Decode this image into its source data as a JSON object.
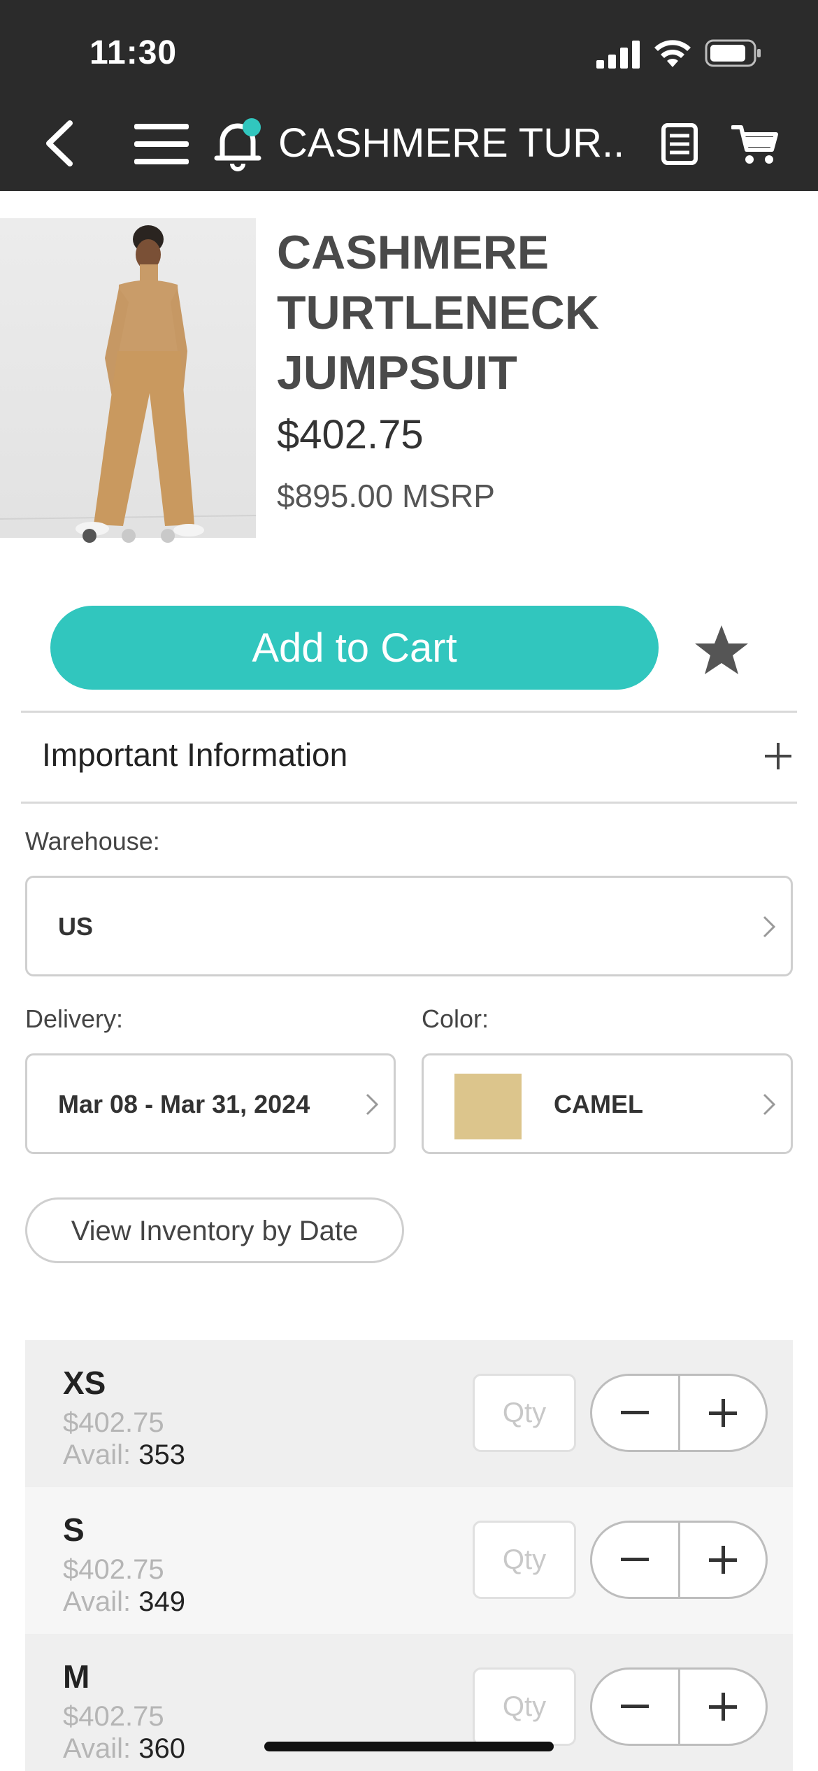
{
  "status_bar": {
    "time": "11:30"
  },
  "nav": {
    "title": "CASHMERE TUR..."
  },
  "product": {
    "name": "CASHMERE TURTLENECK JUMPSUIT",
    "price": "$402.75",
    "msrp": "$895.00 MSRP",
    "image_dots": 3,
    "active_dot": 1
  },
  "actions": {
    "add_to_cart": "Add to Cart"
  },
  "info": {
    "label": "Important Information"
  },
  "warehouse": {
    "label": "Warehouse:",
    "value": "US"
  },
  "delivery": {
    "label": "Delivery:",
    "value": "Mar 08 - Mar 31, 2024"
  },
  "color": {
    "label": "Color:",
    "value": "CAMEL",
    "swatch": "#dcc58c"
  },
  "inventory_button": "View Inventory by Date",
  "sizes": [
    {
      "size": "XS",
      "price": "$402.75",
      "avail_label": "Avail:",
      "avail": "353",
      "qty_placeholder": "Qty"
    },
    {
      "size": "S",
      "price": "$402.75",
      "avail_label": "Avail:",
      "avail": "349",
      "qty_placeholder": "Qty"
    },
    {
      "size": "M",
      "price": "$402.75",
      "avail_label": "Avail:",
      "avail": "360",
      "qty_placeholder": "Qty"
    }
  ],
  "colors": {
    "header_bg": "#2b2b2b",
    "accent": "#31c6be",
    "notification_dot": "#31c6be"
  }
}
